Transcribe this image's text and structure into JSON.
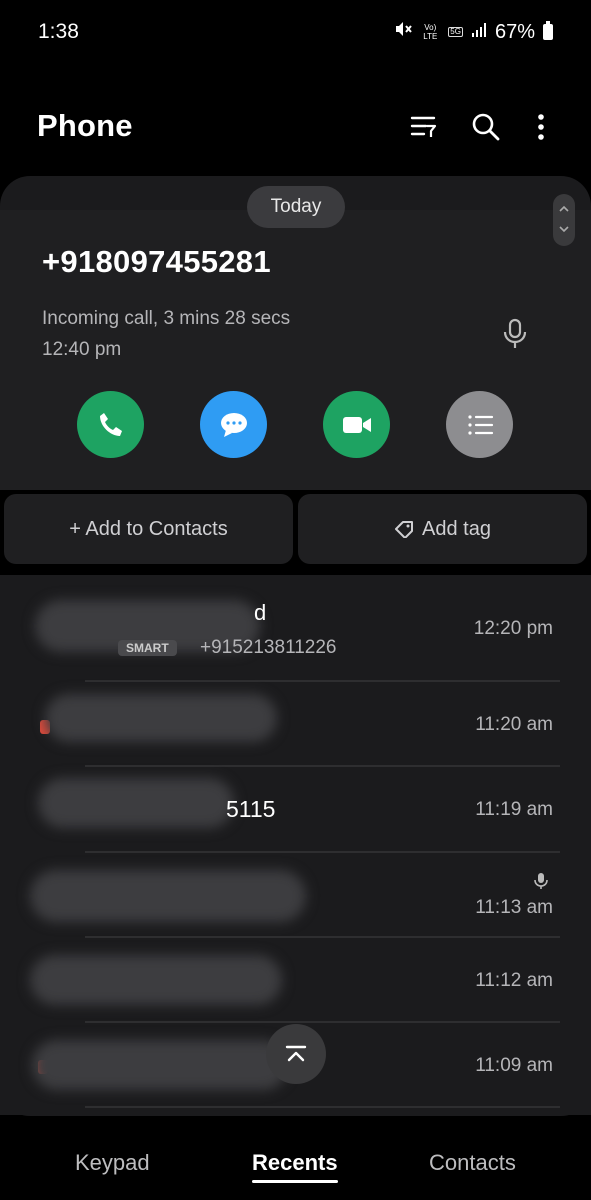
{
  "status_bar": {
    "time": "1:38",
    "volte": "Vo) LTE",
    "network": "5G",
    "battery": "67%"
  },
  "header": {
    "title": "Phone",
    "icons": [
      "filter-icon",
      "search-icon",
      "more-options-icon"
    ]
  },
  "detail": {
    "date_pill": "Today",
    "number": "+918097455281",
    "call_info": "Incoming call, 3 mins 28 secs",
    "call_time": "12:40 pm",
    "actions": [
      {
        "name": "call",
        "color": "#1ea362"
      },
      {
        "name": "message",
        "color": "#2f9cf3"
      },
      {
        "name": "video-call",
        "color": "#1ea362"
      },
      {
        "name": "details",
        "color": "#8d8d90"
      }
    ]
  },
  "buttons": {
    "add_contacts": "+ Add to Contacts",
    "add_tag": "Add tag"
  },
  "calls": [
    {
      "name_partial": "d",
      "badge": "SMART",
      "number_partial": "+915213811226",
      "time": "12:20 pm"
    },
    {
      "name_partial": "",
      "time": "11:20 am",
      "missed": true
    },
    {
      "name_partial": "5115",
      "time": "11:19 am"
    },
    {
      "name_partial": "",
      "time": "11:13 am",
      "recorded": true
    },
    {
      "name_partial": "",
      "time": "11:12 am"
    },
    {
      "name_partial": "",
      "time": "11:09 am",
      "missed": true
    }
  ],
  "nav": {
    "keypad": "Keypad",
    "recents": "Recents",
    "contacts": "Contacts",
    "active": "recents"
  },
  "colors": {
    "background": "#000000",
    "card": "#1b1b1d",
    "green": "#1ea362",
    "blue": "#2f9cf3",
    "missed_red": "#e04a3b"
  }
}
